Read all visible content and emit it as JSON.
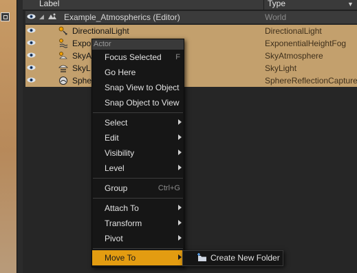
{
  "header": {
    "label": "Label",
    "type": "Type"
  },
  "rows": [
    {
      "name": "Example_Atmospherics (Editor)",
      "type": "World"
    },
    {
      "name": "DirectionalLight",
      "type": "DirectionalLight"
    },
    {
      "name": "Expo",
      "type": "ExponentialHeightFog"
    },
    {
      "name": "SkyA",
      "type": "SkyAtmosphere"
    },
    {
      "name": "SkyL",
      "type": "SkyLight"
    },
    {
      "name": "Sphe",
      "type": "SphereReflectionCapture"
    }
  ],
  "menu": {
    "heading": "Actor",
    "items": [
      {
        "label": "Focus Selected",
        "shortcut": "F"
      },
      {
        "label": "Go Here"
      },
      {
        "label": "Snap View to Object"
      },
      {
        "label": "Snap Object to View"
      },
      {
        "label": "Select"
      },
      {
        "label": "Edit"
      },
      {
        "label": "Visibility"
      },
      {
        "label": "Level"
      },
      {
        "label": "Group",
        "shortcut": "Ctrl+G"
      },
      {
        "label": "Attach To"
      },
      {
        "label": "Transform"
      },
      {
        "label": "Pivot"
      },
      {
        "label": "Move To"
      }
    ]
  },
  "submenu": {
    "create_new_folder": "Create New Folder"
  },
  "colors": {
    "selection": "#c3a06d",
    "highlight": "#e39c11",
    "menu_bg": "#161616"
  },
  "icons": [
    "eye-icon",
    "world-icon",
    "directional-light-icon",
    "fog-icon",
    "sky-atmosphere-icon",
    "sky-light-icon",
    "sphere-reflection-icon",
    "folder-plus-icon"
  ]
}
